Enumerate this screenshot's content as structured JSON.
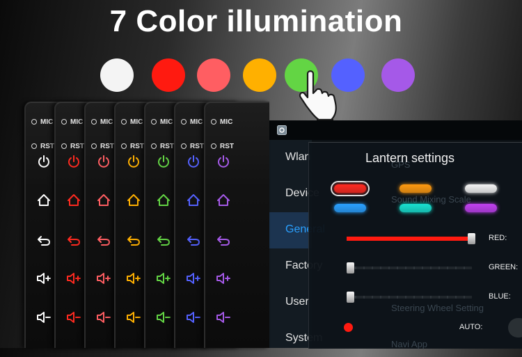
{
  "headline": "7 Color illumination",
  "swatches": [
    {
      "name": "white",
      "color": "#f4f4f4"
    },
    {
      "name": "red",
      "color": "#ff1a10"
    },
    {
      "name": "pink",
      "color": "#ff5e62"
    },
    {
      "name": "orange",
      "color": "#ffb000"
    },
    {
      "name": "green",
      "color": "#63d544"
    },
    {
      "name": "blue",
      "color": "#5461ff"
    },
    {
      "name": "purple",
      "color": "#a559e8"
    }
  ],
  "panels": [
    {
      "mic_label": "MIC",
      "rst_label": "RST",
      "icon_color": "#ffffff"
    },
    {
      "mic_label": "MIC",
      "rst_label": "RST",
      "icon_color": "#ff2a20"
    },
    {
      "mic_label": "MIC",
      "rst_label": "RST",
      "icon_color": "#ff5e62"
    },
    {
      "mic_label": "MIC",
      "rst_label": "RST",
      "icon_color": "#ffb000"
    },
    {
      "mic_label": "MIC",
      "rst_label": "RST",
      "icon_color": "#63d544"
    },
    {
      "mic_label": "MIC",
      "rst_label": "RST",
      "icon_color": "#5461ff"
    },
    {
      "mic_label": "MIC",
      "rst_label": "RST",
      "icon_color": "#a559e8"
    }
  ],
  "panel_buttons": [
    "power-icon",
    "home-icon",
    "back-icon",
    "volume-up-icon",
    "volume-down-icon"
  ],
  "settings_menu": {
    "items": [
      {
        "label": "Wlan",
        "icon": "wifi-icon",
        "active": false
      },
      {
        "label": "Device",
        "icon": "device-icon",
        "active": false
      },
      {
        "label": "General",
        "icon": "gear-icon",
        "active": true
      },
      {
        "label": "Factory",
        "icon": "tools-icon",
        "active": false
      },
      {
        "label": "User",
        "icon": "user-icon",
        "active": false
      },
      {
        "label": "System",
        "icon": "globe-icon",
        "active": false
      }
    ]
  },
  "background_list": [
    "GPS",
    "Sound Mixing Scale",
    "Steering Wheel Setting",
    "Navi App"
  ],
  "lantern": {
    "title": "Lantern settings",
    "presets": [
      {
        "color": "#ff2a20",
        "selected": true
      },
      {
        "color": "#ff9a10",
        "selected": false
      },
      {
        "color": "#f4f4f4",
        "selected": false
      },
      {
        "color": "#2aa0ff",
        "selected": false
      },
      {
        "color": "#18e0d0",
        "selected": false
      },
      {
        "color": "#c040f0",
        "selected": false
      }
    ],
    "sliders": [
      {
        "label": "RED:",
        "value": 1.0,
        "color": "#ff1a10"
      },
      {
        "label": "GREEN:",
        "value": 0.0,
        "color": "#1ec832"
      },
      {
        "label": "BLUE:",
        "value": 0.0,
        "color": "#2a6cff"
      }
    ],
    "auto_label": "AUTO:",
    "indicator_color": "#ff1a10"
  }
}
